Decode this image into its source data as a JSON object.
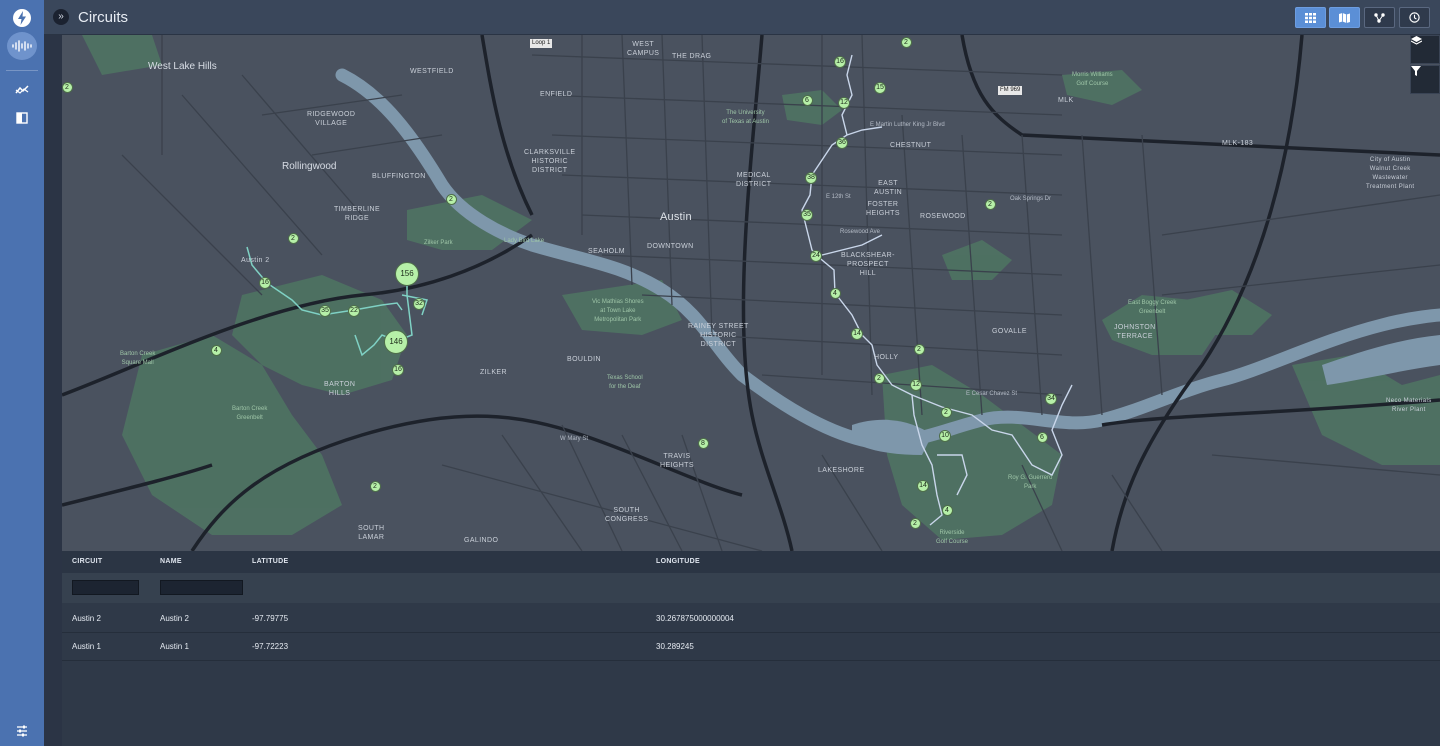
{
  "header": {
    "title": "Circuits",
    "collapse_glyph": "»",
    "view_buttons": [
      {
        "icon": "grid-icon",
        "active": true
      },
      {
        "icon": "map-icon",
        "active": true
      },
      {
        "icon": "graph-icon",
        "active": false
      },
      {
        "icon": "clock-icon",
        "active": false
      }
    ]
  },
  "sidebar": {
    "items": [
      "bolt-icon",
      "waveform-icon",
      "trend-icon",
      "book-icon"
    ],
    "bottom": "sliders-icon"
  },
  "map": {
    "controls": [
      "layers-icon",
      "filter-icon"
    ],
    "labels": {
      "west_lake_hills": "West Lake Hills",
      "westfield": "WESTFIELD",
      "west_campus": "WEST\nCAMPUS",
      "the_drag": "THE DRAG",
      "enfield": "ENFIELD",
      "ridgewood": "RIDGEWOOD\nVILLAGE",
      "clarksville": "CLARKSVILLE\nHISTORIC\nDISTRICT",
      "ut": "The University\nof Texas at Austin",
      "chestnut": "CHESTNUT",
      "rollingwood": "Rollingwood",
      "bluffington": "BLUFFINGTON",
      "timberline": "TIMBERLINE\nRIDGE",
      "medical": "MEDICAL\nDISTRICT",
      "austin": "Austin",
      "east_austin": "EAST\nAUSTIN",
      "foster": "FOSTER\nHEIGHTS",
      "rosewood": "ROSEWOOD",
      "zilker_park": "Zilker Park",
      "lady_bird": "Lady Bird Lake",
      "seaholm": "SEAHOLM",
      "downtown": "DOWNTOWN",
      "blackshear": "BLACKSHEAR-\nPROSPECT\nHILL",
      "austin2": "Austin 2",
      "barton_creek": "Barton Creek\nSquare Mall",
      "mathias": "Vic Mathias Shores\nat Town Lake\nMetropolitan Park",
      "rainey": "RAINEY STREET\nHISTORIC\nDISTRICT",
      "holly": "HOLLY",
      "govalle": "GOVALLE",
      "johnston": "JOHNSTON\nTERRACE",
      "bouldin": "BOULDIN",
      "texas_school": "Texas School\nfor the Deaf",
      "barton_hills": "BARTON\nHILLS",
      "zilker": "ZILKER",
      "barton_greenbelt": "Barton Creek\nGreenbelt",
      "barton_greenbelt2": "Barton Creek\nGreenbelt",
      "travis": "TRAVIS\nHEIGHTS",
      "lakeshore": "LAKESHORE",
      "south_congress": "SOUTH\nCONGRESS",
      "south_lamar": "SOUTH\nLAMAR",
      "galindo": "GALINDO",
      "mlk": "MLK",
      "mlk183": "MLK-183",
      "morris": "Morris Williams\nGolf Course",
      "walnut": "City of Austin\nWalnut Creek\nWastewater\nTreatment Plant",
      "east_boggy": "East Boggy Creek\nGreenbelt",
      "roy": "Roy G. Guerrero\nPark",
      "riverside": "Riverside\nGolf Course",
      "neco": "Neco Materials\nRiver Plant",
      "east_12th": "E 12th St",
      "mlk_blvd": "E Martin Luther King Jr Blvd",
      "cesar": "E Cesar Chavez St",
      "oak_springs": "Oak Springs Dr",
      "w_mary": "W Mary St",
      "rosewood_ave": "Rosewood Ave",
      "loop1": "Loop 1",
      "fm969": "FM 969"
    },
    "clusters": [
      {
        "count": "2",
        "size": 11
      },
      {
        "count": "2",
        "size": 11
      },
      {
        "count": "2",
        "size": 11
      },
      {
        "count": "2",
        "size": 11
      },
      {
        "count": "16",
        "size": 12
      },
      {
        "count": "156",
        "size": 24
      },
      {
        "count": "32",
        "size": 12
      },
      {
        "count": "35",
        "size": 12
      },
      {
        "count": "22",
        "size": 12
      },
      {
        "count": "146",
        "size": 24
      },
      {
        "count": "4",
        "size": 11
      },
      {
        "count": "16",
        "size": 12
      },
      {
        "count": "2",
        "size": 11
      },
      {
        "count": "8",
        "size": 11
      },
      {
        "count": "16",
        "size": 12
      },
      {
        "count": "15",
        "size": 12
      },
      {
        "count": "12",
        "size": 12
      },
      {
        "count": "6",
        "size": 11
      },
      {
        "count": "2",
        "size": 11
      },
      {
        "count": "36",
        "size": 12
      },
      {
        "count": "38",
        "size": 12
      },
      {
        "count": "35",
        "size": 12
      },
      {
        "count": "24",
        "size": 12
      },
      {
        "count": "4",
        "size": 11
      },
      {
        "count": "14",
        "size": 12
      },
      {
        "count": "2",
        "size": 11
      },
      {
        "count": "2",
        "size": 11
      },
      {
        "count": "12",
        "size": 12
      },
      {
        "count": "2",
        "size": 11
      },
      {
        "count": "10",
        "size": 12
      },
      {
        "count": "34",
        "size": 12
      },
      {
        "count": "6",
        "size": 11
      },
      {
        "count": "14",
        "size": 12
      },
      {
        "count": "4",
        "size": 11
      },
      {
        "count": "2",
        "size": 11
      }
    ]
  },
  "table": {
    "columns": [
      "CIRCUIT",
      "NAME",
      "LATITUDE",
      "LONGITUDE"
    ],
    "filters": {
      "circuit": "",
      "name": ""
    },
    "rows": [
      {
        "circuit": "Austin 2",
        "name": "Austin 2",
        "latitude": "-97.79775",
        "longitude": "30.267875000000004"
      },
      {
        "circuit": "Austin 1",
        "name": "Austin 1",
        "latitude": "-97.72223",
        "longitude": "30.289245"
      }
    ]
  }
}
